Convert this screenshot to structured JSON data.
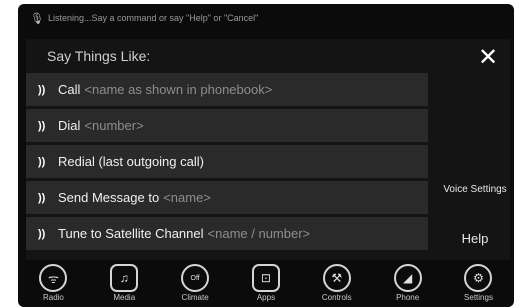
{
  "status": {
    "text": "Listening...Say a command or say \"Help\" or \"Cancel\"",
    "icon": "mic-listening-icon"
  },
  "panel": {
    "title": "Say Things Like:",
    "close_label": "✕",
    "commands": [
      {
        "text": "Call",
        "hint": "<name as shown in phonebook>"
      },
      {
        "text": "Dial",
        "hint": "<number>"
      },
      {
        "text": "Redial (last outgoing call)",
        "hint": ""
      },
      {
        "text": "Send Message to",
        "hint": "<name>"
      },
      {
        "text": "Tune to Satellite Channel",
        "hint": "<name / number>"
      }
    ],
    "voice_settings": "Voice Settings",
    "help": "Help"
  },
  "nav": [
    {
      "label": "Radio",
      "icon": "radio-icon",
      "glyph": "ᯤ"
    },
    {
      "label": "Media",
      "icon": "music-note-icon",
      "glyph": "♫"
    },
    {
      "label": "Climate",
      "icon": "climate-off-icon",
      "glyph": "Off"
    },
    {
      "label": "Apps",
      "icon": "apps-icon",
      "glyph": "⊡"
    },
    {
      "label": "Controls",
      "icon": "wrench-icon",
      "glyph": "⚒"
    },
    {
      "label": "Phone",
      "icon": "phone-icon",
      "glyph": "◢"
    },
    {
      "label": "Settings",
      "icon": "gear-icon",
      "glyph": "⚙"
    }
  ],
  "colors": {
    "background": "#0b0b0b",
    "row": "#2a2a2a",
    "hint": "#8d8d8d",
    "text": "#f0f0f0"
  }
}
